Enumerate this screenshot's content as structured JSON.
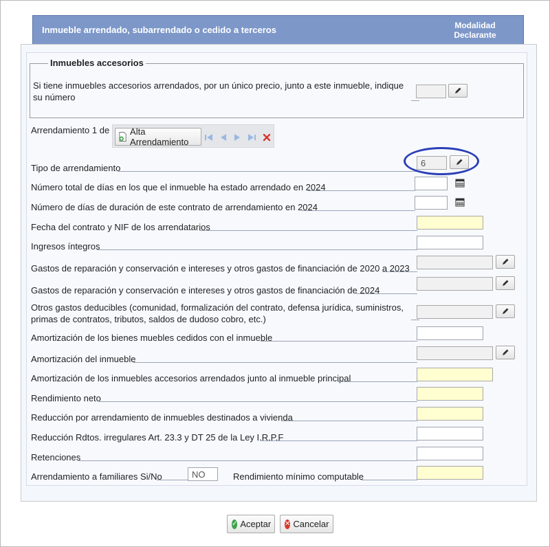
{
  "header": {
    "title": "Inmueble arrendado, subarrendado o cedido a terceros",
    "mode_line1": "Modalidad",
    "mode_line2": "Declarante"
  },
  "accesorios": {
    "legend": "Inmuebles accesorios",
    "question": "Si tiene inmuebles accesorios arrendados, por un único precio, junto a este inmueble, indique su número",
    "value": ""
  },
  "arrendamiento": {
    "counter": "Arrendamiento 1 de 1",
    "alta_label": "Alta Arrendamiento"
  },
  "fields": {
    "tipo": {
      "label": "Tipo de arrendamiento",
      "value": "6"
    },
    "dias_total": {
      "label": "Número total de días en los que el inmueble ha estado arrendado en 2024",
      "value": ""
    },
    "dias_contrato": {
      "label": "Número de días de duración de este contrato de arrendamiento en 2024",
      "value": ""
    },
    "fecha_nif": {
      "label": "Fecha del contrato y NIF de los arrendatarios",
      "value": ""
    },
    "ingresos": {
      "label": "Ingresos íntegros",
      "value": ""
    },
    "gastos_2020_2023": {
      "label": "Gastos de reparación y conservación e intereses y otros gastos de financiación de 2020 a 2023",
      "value": ""
    },
    "gastos_2024": {
      "label": "Gastos de reparación y conservación e intereses y otros gastos de financiación de 2024",
      "value": ""
    },
    "otros_gastos": {
      "label": "Otros gastos deducibles (comunidad, formalización del contrato, defensa jurídica, suministros, primas de contratos, tributos, saldos de dudoso cobro, etc.)",
      "value": ""
    },
    "amort_muebles": {
      "label": "Amortización de los bienes muebles cedidos con el inmueble",
      "value": ""
    },
    "amort_inmueble": {
      "label": "Amortización del inmueble",
      "value": ""
    },
    "amort_accesorios": {
      "label": "Amortización de los inmuebles accesorios arrendados junto al inmueble principal",
      "value": ""
    },
    "rendimiento_neto": {
      "label": "Rendimiento neto",
      "value": ""
    },
    "reduccion_vivienda": {
      "label": "Reducción por arrendamiento de inmuebles destinados a vivienda",
      "value": ""
    },
    "reduccion_irregulares": {
      "label": "Reducción Rdtos. irregulares Art. 23.3 y DT 25 de la Ley I.R.P.F",
      "value": ""
    },
    "retenciones": {
      "label": "Retenciones",
      "value": ""
    },
    "familiares": {
      "label": "Arrendamiento a familiares Si/No",
      "value": "NO"
    },
    "rend_minimo": {
      "label": "Rendimiento mínimo computable",
      "value": ""
    }
  },
  "footer": {
    "accept_label": "Aceptar",
    "cancel_label": "Cancelar"
  },
  "colors": {
    "header": "#7d97c9",
    "highlight": "#2b3fb5",
    "computed_field": "#fffed0"
  }
}
